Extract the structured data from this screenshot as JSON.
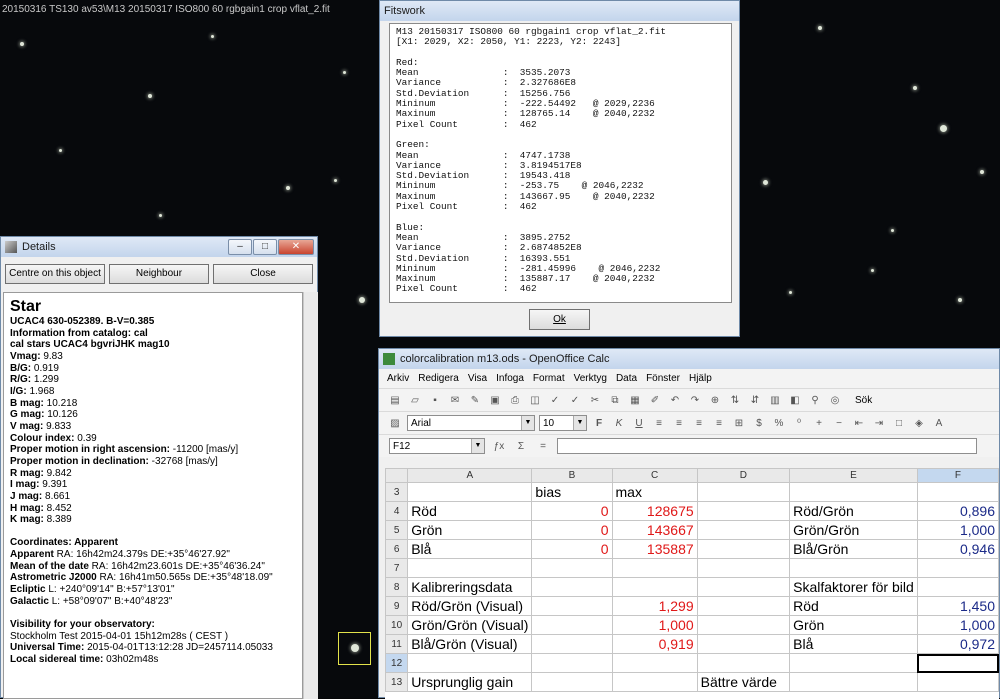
{
  "background": {
    "image_title": "20150316 TS130 av53\\M13 20150317 ISO800 60 rgbgain1 crop vflat_2.fit"
  },
  "fitswork": {
    "title": "Fitswork",
    "report_lines": [
      "M13 20150317 ISO800 60 rgbgain1 crop vflat_2.fit",
      "[X1: 2029, X2: 2050, Y1: 2223, Y2: 2243]",
      "",
      "Red:",
      "Mean               :  3535.2073",
      "Variance           :  2.327686E8",
      "Std.Deviation      :  15256.756",
      "Mininum            :  -222.54492   @ 2029,2236",
      "Maxinum            :  128765.14    @ 2040,2232",
      "Pixel Count        :  462",
      "",
      "Green:",
      "Mean               :  4747.1738",
      "Variance           :  3.8194517E8",
      "Std.Deviation      :  19543.418",
      "Mininum            :  -253.75    @ 2046,2232",
      "Maxinum            :  143667.95    @ 2040,2232",
      "Pixel Count        :  462",
      "",
      "Blue:",
      "Mean               :  3895.2752",
      "Variance           :  2.6874852E8",
      "Std.Deviation      :  16393.551",
      "Mininum            :  -281.45996    @ 2046,2232",
      "Maxinum            :  135887.17    @ 2040,2232",
      "Pixel Count        :  462"
    ],
    "ok_label": "Ok"
  },
  "details": {
    "title": "Details",
    "buttons": {
      "centre": "Centre on this object",
      "neighbour": "Neighbour",
      "close": "Close"
    },
    "heading": "Star",
    "lines": [
      {
        "t": "UCAC4 630-052389. B-V=0.385",
        "bold": true
      },
      {
        "t": "Information from catalog: cal",
        "bold": true
      },
      {
        "t": "cal stars UCAC4 bgvriJHK mag10",
        "bold": true
      },
      {
        "k": "Vmag:",
        "v": " 9.83"
      },
      {
        "k": "B/G:",
        "v": " 0.919"
      },
      {
        "k": "R/G:",
        "v": " 1.299"
      },
      {
        "k": "I/G:",
        "v": " 1.968"
      },
      {
        "k": "B mag:",
        "v": " 10.218"
      },
      {
        "k": "G mag:",
        "v": " 10.126"
      },
      {
        "k": "V mag:",
        "v": " 9.833"
      },
      {
        "k": "Colour index:",
        "v": " 0.39"
      },
      {
        "k": "Proper motion in right ascension:",
        "v": " -11200 [mas/y]"
      },
      {
        "k": "Proper motion in declination:",
        "v": " -32768 [mas/y]"
      },
      {
        "k": "R mag:",
        "v": " 9.842"
      },
      {
        "k": "I mag:",
        "v": " 9.391"
      },
      {
        "k": "J mag:",
        "v": " 8.661"
      },
      {
        "k": "H mag:",
        "v": " 8.452"
      },
      {
        "k": "K mag:",
        "v": " 8.389"
      },
      {
        "t": ""
      },
      {
        "t": "Coordinates: Apparent",
        "bold": true
      },
      {
        "k": "Apparent",
        "v": " RA:  16h42m24.379s DE:+35°46'27.92\""
      },
      {
        "k": "Mean of the date",
        "v": " RA:  16h42m23.601s DE:+35°46'36.24\""
      },
      {
        "k": "Astrometric J2000",
        "v": " RA:  16h41m50.565s DE:+35°48'18.09\""
      },
      {
        "k": "Ecliptic",
        "v": "  L: +240°09'14\" B:+57°13'01\""
      },
      {
        "k": "Galactic",
        "v": "  L: +58°09'07\" B:+40°48'23\""
      },
      {
        "t": ""
      },
      {
        "t": "Visibility for your observatory:",
        "bold": true
      },
      {
        "t": "Stockholm Test  2015-04-01 15h12m28s ( CEST )"
      },
      {
        "k": "Universal Time:",
        "v": " 2015-04-01T13:12:28 JD=2457114.05033"
      },
      {
        "k": "Local sidereal time:",
        "v": " 03h02m48s"
      }
    ]
  },
  "calc": {
    "title": "colorcalibration m13.ods - OpenOffice Calc",
    "menu": [
      "Arkiv",
      "Redigera",
      "Visa",
      "Infoga",
      "Format",
      "Verktyg",
      "Data",
      "Fönster",
      "Hjälp"
    ],
    "font_name": "Arial",
    "font_size": "10",
    "cell_ref": "F12",
    "toolbar_text": "Sök",
    "columns": [
      "A",
      "B",
      "C",
      "D",
      "E",
      "F"
    ],
    "rows": [
      {
        "n": "3",
        "cells": [
          "",
          "bias",
          "max",
          "",
          "",
          ""
        ]
      },
      {
        "n": "4",
        "cells": [
          "Röd",
          "0",
          "128675",
          "",
          "Röd/Grön",
          "0,896"
        ]
      },
      {
        "n": "5",
        "cells": [
          "Grön",
          "0",
          "143667",
          "",
          "Grön/Grön",
          "1,000"
        ]
      },
      {
        "n": "6",
        "cells": [
          "Blå",
          "0",
          "135887",
          "",
          "Blå/Grön",
          "0,946"
        ]
      },
      {
        "n": "7",
        "cells": [
          "",
          "",
          "",
          "",
          "",
          ""
        ]
      },
      {
        "n": "8",
        "cells": [
          "Kalibreringsdata",
          "",
          "",
          "",
          "Skalfaktorer för bild",
          ""
        ]
      },
      {
        "n": "9",
        "cells": [
          "Röd/Grön (Visual)",
          "",
          "1,299",
          "",
          "Röd",
          "1,450"
        ]
      },
      {
        "n": "10",
        "cells": [
          "Grön/Grön (Visual)",
          "",
          "1,000",
          "",
          "Grön",
          "1,000"
        ]
      },
      {
        "n": "11",
        "cells": [
          "Blå/Grön (Visual)",
          "",
          "0,919",
          "",
          "Blå",
          "0,972"
        ]
      },
      {
        "n": "12",
        "cells": [
          "",
          "",
          "",
          "",
          "",
          ""
        ]
      },
      {
        "n": "13",
        "cells": [
          "Ursprunglig gain",
          "",
          "",
          "Bättre värde",
          "",
          ""
        ]
      }
    ]
  }
}
